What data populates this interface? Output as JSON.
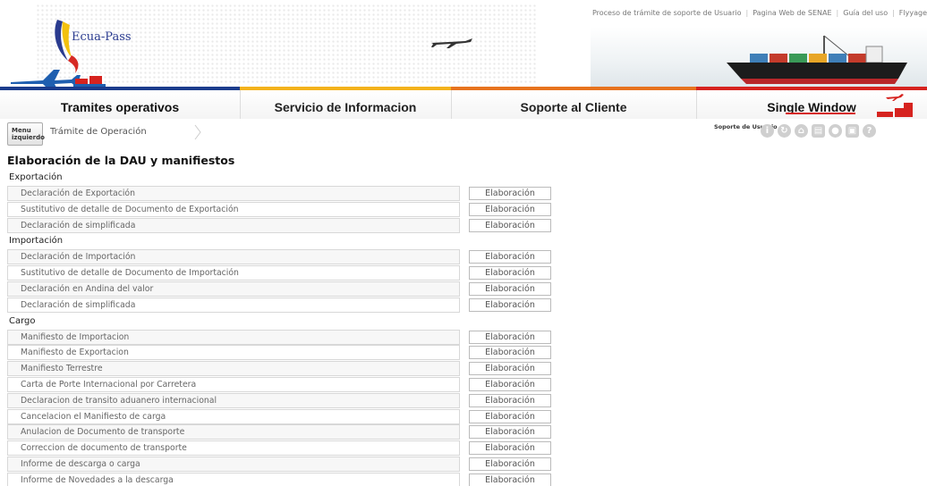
{
  "header": {
    "logo_text": "Ecua-Pass",
    "top_links": [
      "Proceso de trámite de soporte de Usuario",
      "Pagina Web de SENAE",
      "Guía del uso",
      "Flyyage"
    ]
  },
  "nav": {
    "items": [
      {
        "label": "Tramites operativos"
      },
      {
        "label": "Servicio de Informacion"
      },
      {
        "label": "Soporte al Cliente"
      },
      {
        "label": "Single Window"
      }
    ]
  },
  "toolbar": {
    "menu_button": "Menu izquierdo",
    "breadcrumb": "Trámite de Operación",
    "support_label": "Soporte de Usuario",
    "icons": [
      "info-icon",
      "refresh-icon",
      "home-icon",
      "print-icon",
      "user-icon",
      "save-icon",
      "help-icon"
    ]
  },
  "page": {
    "title": "Elaboración de la DAU y manifiestos",
    "button_label": "Elaboración",
    "sections": [
      {
        "title": "Exportación",
        "items": [
          "Declaración de Exportación",
          "Sustitutivo de detalle de Documento de Exportación",
          "Declaración de simplificada"
        ]
      },
      {
        "title": "Importación",
        "items": [
          "Declaración de Importación",
          "Sustitutivo de detalle de Documento de Importación",
          "Declaración en Andina del valor",
          "Declaración de simplificada"
        ]
      },
      {
        "title": "Cargo",
        "items": [
          "Manifiesto de Importacion",
          "Manifiesto de Exportacion",
          "Manifiesto Terrestre",
          "Carta de Porte Internacional por Carretera",
          "Declaracion de transito aduanero internacional",
          "Cancelacion el Manifiesto de carga",
          "Anulacion de Documento de transporte",
          "Correccion de documento de transporte",
          "Informe de descarga o carga",
          "Informe de Novedades a la descarga"
        ]
      }
    ]
  },
  "colors": {
    "nav_blue": "#1b3c8c",
    "nav_yellow": "#f3b21b",
    "nav_orange": "#e7731e",
    "nav_red": "#d6231f"
  }
}
